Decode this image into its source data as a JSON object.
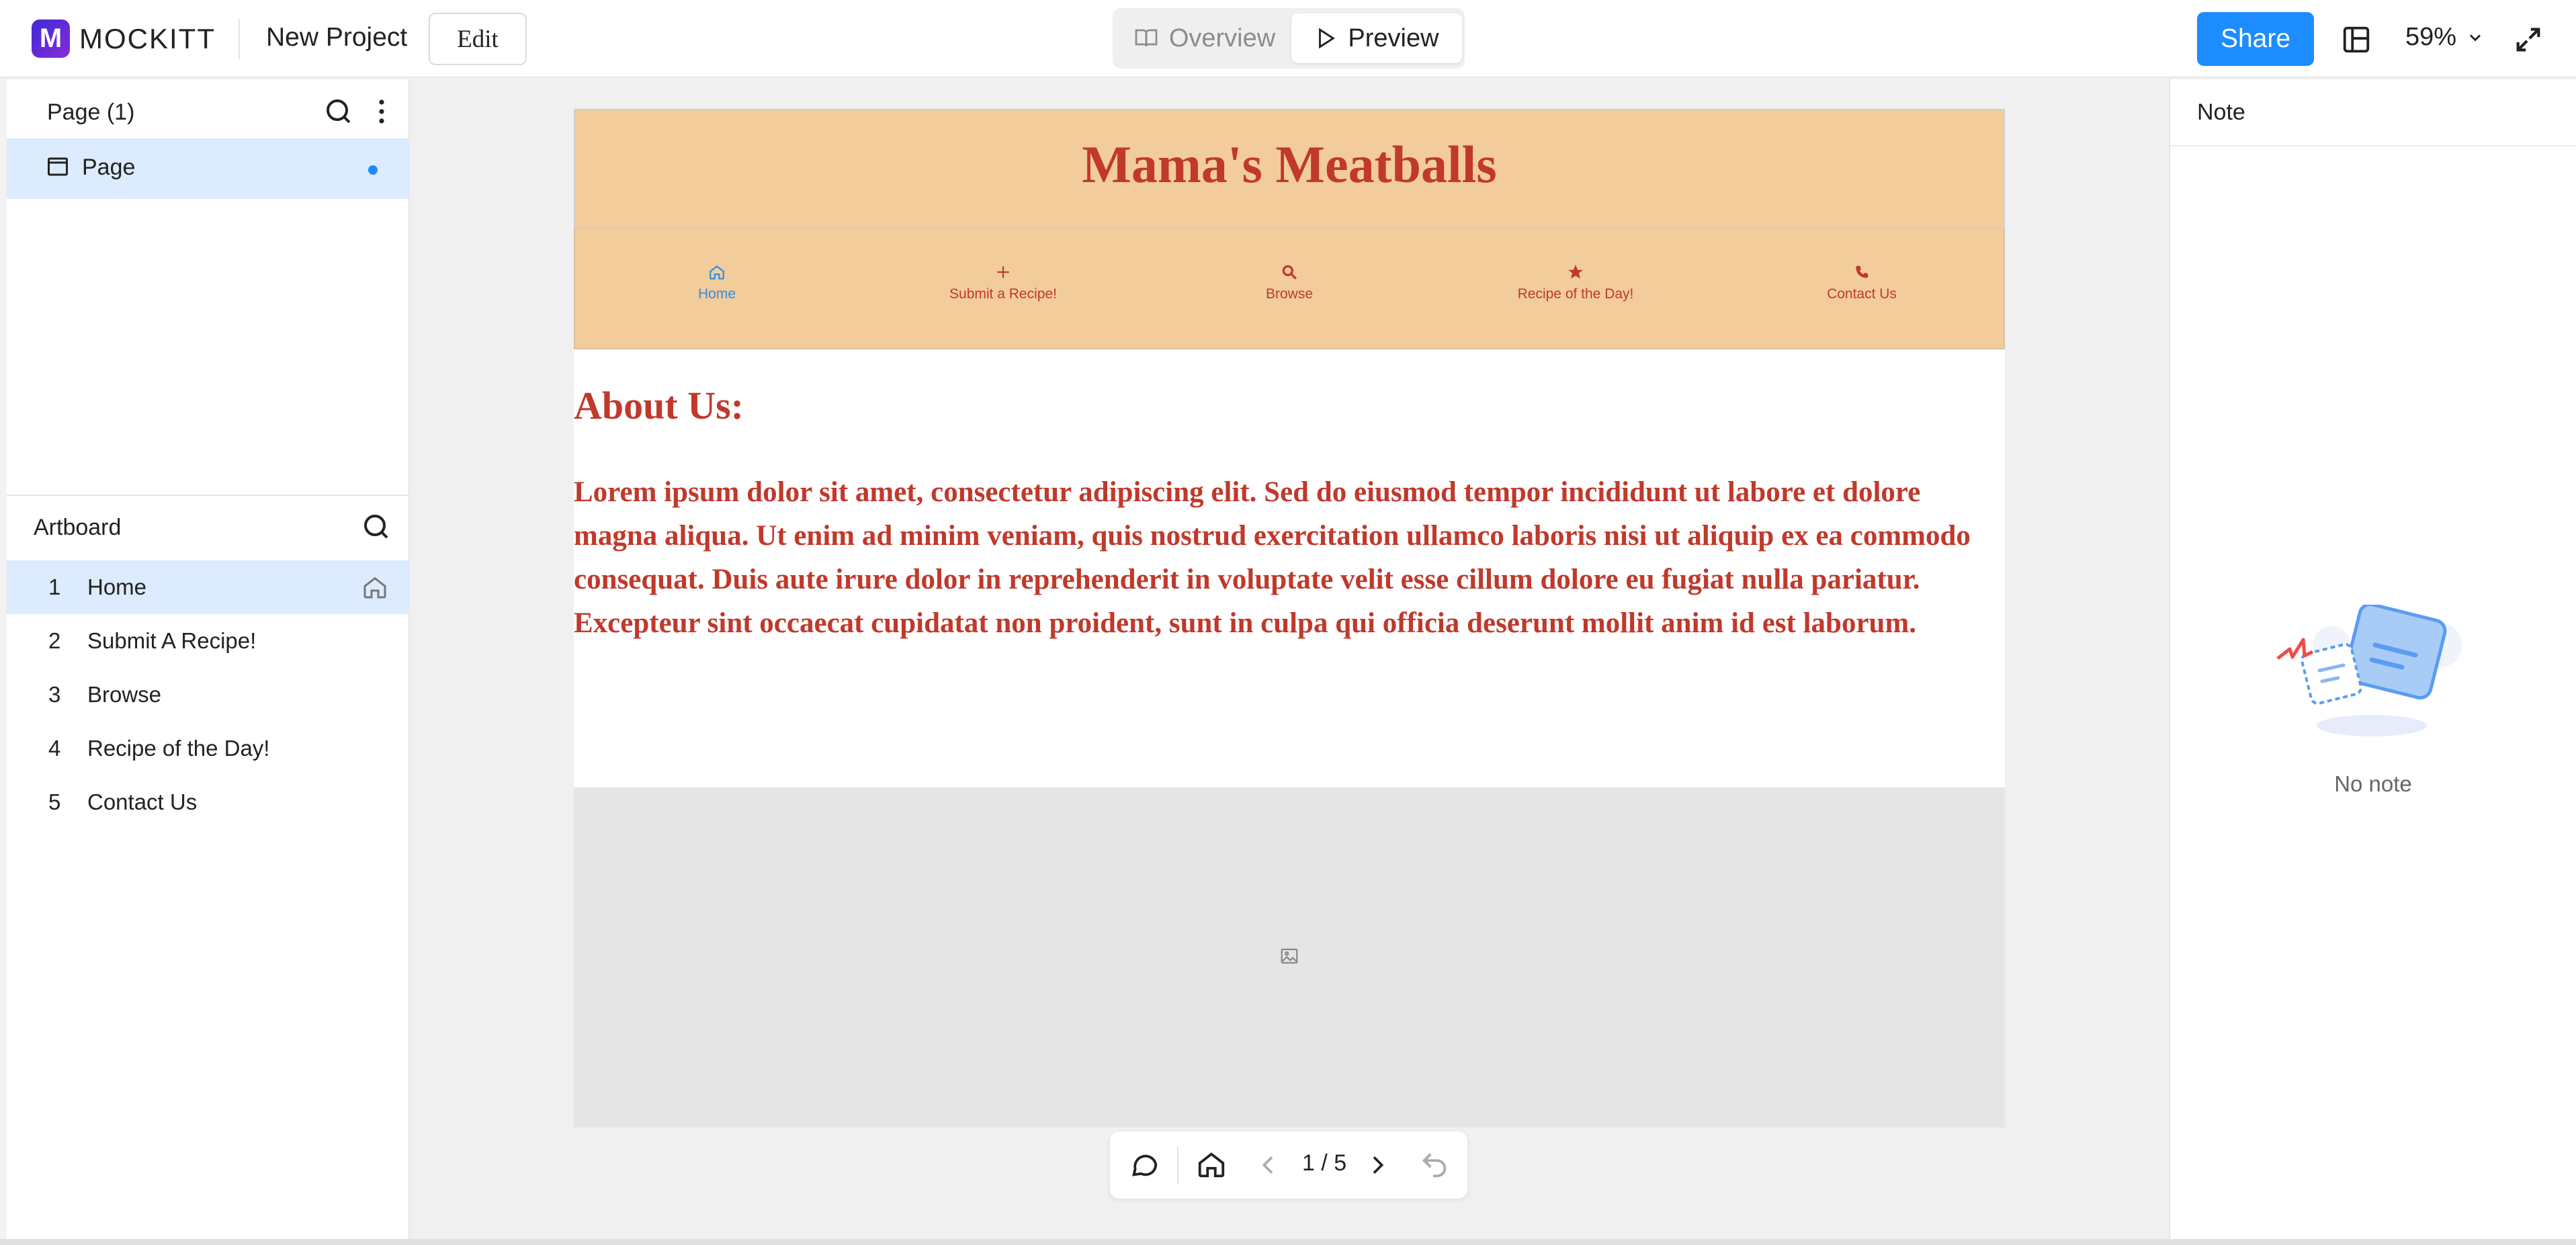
{
  "app": {
    "brand": "MOCKITT",
    "project_name": "New Project",
    "edit_label": "Edit",
    "overview_label": "Overview",
    "preview_label": "Preview",
    "share_label": "Share",
    "zoom": "59%"
  },
  "left_panel": {
    "page_header": "Page  (1)",
    "page_item": "Page",
    "artboard_header": "Artboard",
    "artboards": [
      {
        "num": "1",
        "label": "Home"
      },
      {
        "num": "2",
        "label": "Submit A Recipe!"
      },
      {
        "num": "3",
        "label": "Browse"
      },
      {
        "num": "4",
        "label": "Recipe of the Day!"
      },
      {
        "num": "5",
        "label": "Contact Us"
      }
    ]
  },
  "board": {
    "title": "Mama's Meatballs",
    "nav": [
      {
        "label": "Home",
        "icon": "home-icon"
      },
      {
        "label": "Submit a Recipe!",
        "icon": "plus-icon"
      },
      {
        "label": "Browse",
        "icon": "search-icon"
      },
      {
        "label": "Recipe of the Day!",
        "icon": "star-icon"
      },
      {
        "label": "Contact Us",
        "icon": "phone-icon"
      }
    ],
    "about_heading": "About Us:",
    "about_text": "Lorem ipsum dolor sit amet, consectetur adipiscing elit. Sed do eiusmod tempor incididunt ut labore et dolore magna aliqua. Ut enim ad minim veniam, quis nostrud exercitation ullamco laboris nisi ut aliquip ex ea commodo consequat. Duis aute irure dolor in reprehenderit in voluptate velit esse cillum dolore eu fugiat nulla pariatur. Excepteur sint occaecat cupidatat non proident, sunt in culpa qui officia deserunt mollit anim id est laborum."
  },
  "bottom_toolbar": {
    "page_indicator": "1 / 5"
  },
  "right_panel": {
    "title": "Note",
    "empty_text": "No note"
  },
  "colors": {
    "accent": "#1c8cff",
    "header_band": "#f2cc9b",
    "brand_red": "#c0392b",
    "selection": "#dcebfd"
  }
}
